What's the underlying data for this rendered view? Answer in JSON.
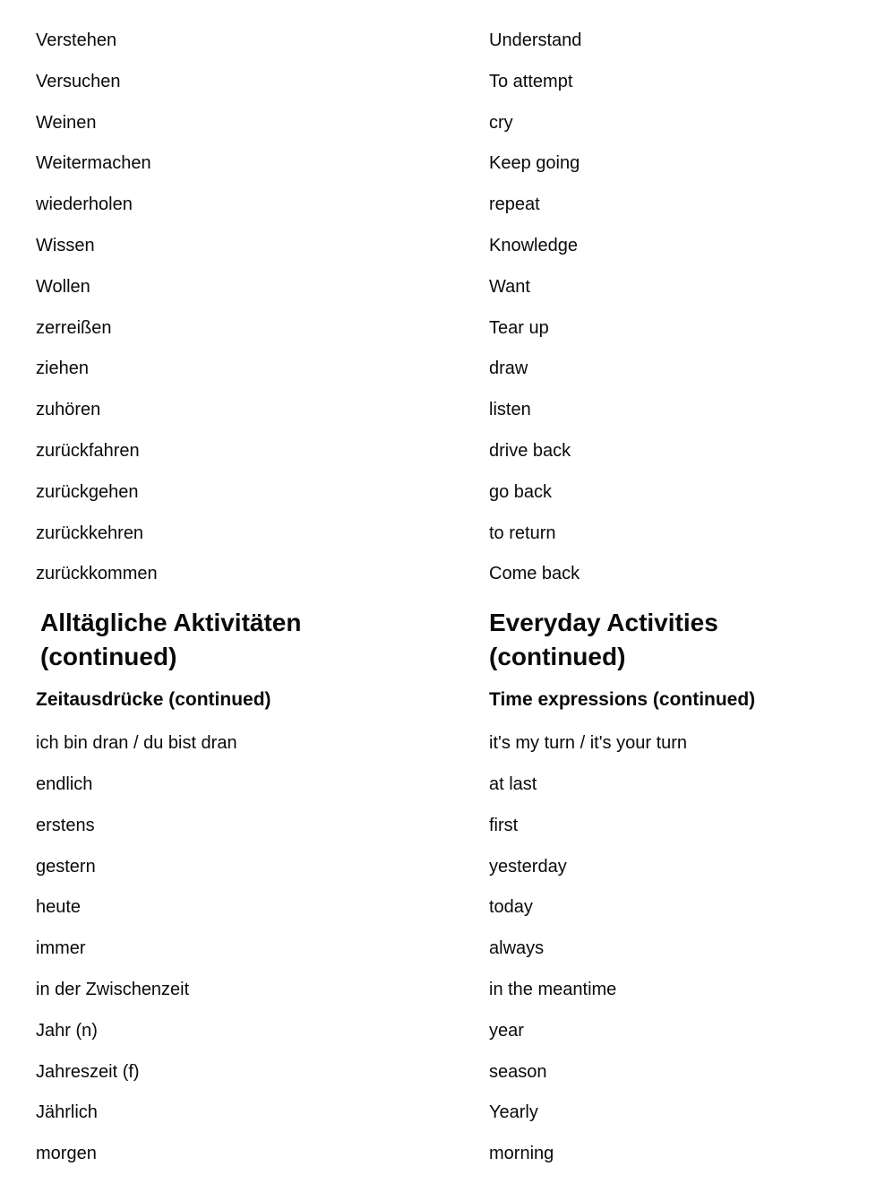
{
  "document": {
    "background_color": "#ffffff",
    "text_color": "#0a0a0a",
    "columns": {
      "left_language": "German",
      "right_language": "English"
    }
  },
  "top_list": {
    "entries": [
      {
        "term": "Verstehen",
        "gloss": "Understand"
      },
      {
        "term": "Versuchen",
        "gloss": "To attempt"
      },
      {
        "term": "Weinen",
        "gloss": "cry"
      },
      {
        "term": "Weitermachen",
        "gloss": "Keep going"
      },
      {
        "term": "wiederholen",
        "gloss": "repeat"
      },
      {
        "term": "Wissen",
        "gloss": "Knowledge"
      },
      {
        "term": "Wollen",
        "gloss": "Want"
      },
      {
        "term": "zerreißen",
        "gloss": "Tear up"
      },
      {
        "term": "ziehen",
        "gloss": "draw"
      },
      {
        "term": "zuhören",
        "gloss": "listen"
      },
      {
        "term": "zurückfahren",
        "gloss": "drive back"
      },
      {
        "term": "zurückgehen",
        "gloss": "go back"
      },
      {
        "term": "zurückkehren",
        "gloss": "to return"
      },
      {
        "term": "zurückkommen",
        "gloss": "Come back"
      }
    ]
  },
  "section": {
    "title_left": "Alltägliche Aktivitäten\n(continued)",
    "title_right": "Everyday Activities\n(continued)",
    "subtitle_left": "Zeitausdrücke (continued)",
    "subtitle_right": "Time expressions (continued)"
  },
  "bottom_list": {
    "entries": [
      {
        "term": "ich bin dran / du bist dran",
        "gloss": "it's my turn / it's your turn"
      },
      {
        "term": "endlich",
        "gloss": "at last"
      },
      {
        "term": "erstens",
        "gloss": "first"
      },
      {
        "term": "gestern",
        "gloss": "yesterday"
      },
      {
        "term": "heute",
        "gloss": "today"
      },
      {
        "term": "immer",
        "gloss": "always"
      },
      {
        "term": "in der Zwischenzeit",
        "gloss": "in the meantime"
      },
      {
        "term": "Jahr (n)",
        "gloss": "year"
      },
      {
        "term": "Jahreszeit (f)",
        "gloss": "season"
      },
      {
        "term": "Jährlich",
        "gloss": "Yearly"
      },
      {
        "term": "morgen",
        "gloss": "morning"
      }
    ]
  }
}
